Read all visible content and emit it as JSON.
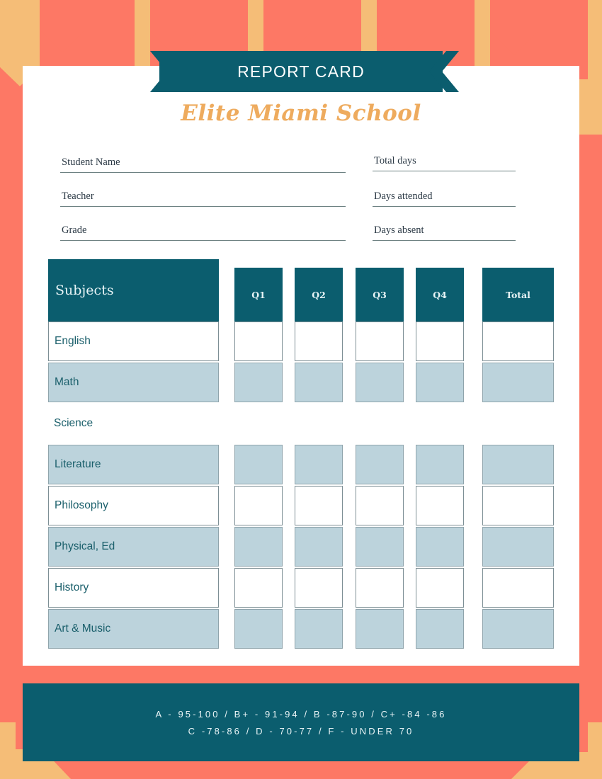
{
  "theme": {
    "teal": "#0b5d6e",
    "coral": "#fd7865",
    "tan": "#f5bd77",
    "light_blue": "#bcd3dc",
    "orange_title": "#eeab5e",
    "card_white": "#ffffff",
    "subject_text": "#1a5f6b"
  },
  "banner": {
    "title": "REPORT CARD",
    "chevron_left_icon": "double-chevron-right-icon",
    "chevron_right_icon": "double-chevron-left-icon"
  },
  "school": {
    "name": "Elite Miami School"
  },
  "form": {
    "left": [
      {
        "label": "Student Name",
        "value": ""
      },
      {
        "label": "Teacher",
        "value": ""
      },
      {
        "label": "Grade",
        "value": ""
      }
    ],
    "right": [
      {
        "label": "Total days",
        "value": ""
      },
      {
        "label": "Days attended",
        "value": ""
      },
      {
        "label": "Days absent",
        "value": ""
      }
    ]
  },
  "table": {
    "headers": {
      "subjects": "Subjects",
      "q1": "Q1",
      "q2": "Q2",
      "q3": "Q3",
      "q4": "Q4",
      "total": "Total"
    },
    "rows": [
      {
        "subject": "English",
        "style": "plain",
        "q1": "",
        "q2": "",
        "q3": "",
        "q4": "",
        "total": ""
      },
      {
        "subject": "Math",
        "style": "fill",
        "q1": "",
        "q2": "",
        "q3": "",
        "q4": "",
        "total": ""
      },
      {
        "subject": "Science",
        "style": "none",
        "q1": "",
        "q2": "",
        "q3": "",
        "q4": "",
        "total": ""
      },
      {
        "subject": "Literature",
        "style": "fill",
        "q1": "",
        "q2": "",
        "q3": "",
        "q4": "",
        "total": ""
      },
      {
        "subject": "Philosophy",
        "style": "plain",
        "q1": "",
        "q2": "",
        "q3": "",
        "q4": "",
        "total": ""
      },
      {
        "subject": "Physical, Ed",
        "style": "fill",
        "q1": "",
        "q2": "",
        "q3": "",
        "q4": "",
        "total": ""
      },
      {
        "subject": "History",
        "style": "plain",
        "q1": "",
        "q2": "",
        "q3": "",
        "q4": "",
        "total": ""
      },
      {
        "subject": "Art & Music",
        "style": "fill",
        "q1": "",
        "q2": "",
        "q3": "",
        "q4": "",
        "total": ""
      }
    ]
  },
  "grading_scale": {
    "line1": "A - 95-100 / B+ - 91-94 / B -87-90 / C+ -84 -86",
    "line2": "C -78-86 / D - 70-77 / F - UNDER 70"
  }
}
